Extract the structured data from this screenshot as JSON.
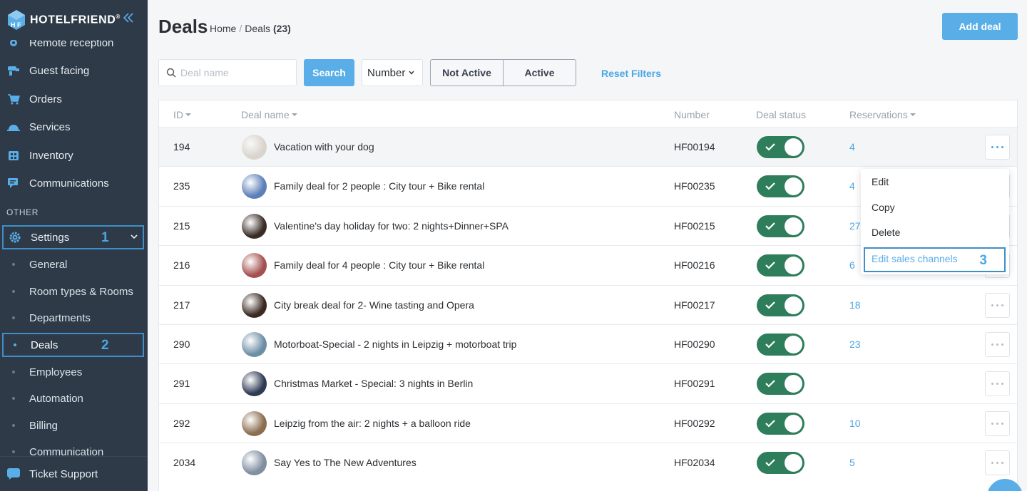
{
  "brand": {
    "name": "HOTELFRIEND",
    "reg": "®"
  },
  "sidebar": {
    "items": [
      {
        "label": "Remote reception",
        "icon": "gear-small-icon"
      },
      {
        "label": "Guest facing",
        "icon": "concierge-icon"
      },
      {
        "label": "Orders",
        "icon": "cart-icon"
      },
      {
        "label": "Services",
        "icon": "cloche-icon"
      },
      {
        "label": "Inventory",
        "icon": "building-icon"
      },
      {
        "label": "Communications",
        "icon": "chat-icon"
      }
    ],
    "section_other": "OTHER",
    "settings": {
      "label": "Settings",
      "step": "1"
    },
    "sub_items": [
      {
        "label": "General"
      },
      {
        "label": "Room types & Rooms"
      },
      {
        "label": "Departments"
      },
      {
        "label": "Deals",
        "step": "2"
      },
      {
        "label": "Employees"
      },
      {
        "label": "Automation"
      },
      {
        "label": "Billing"
      },
      {
        "label": "Communication"
      }
    ],
    "support": {
      "label": "Ticket Support"
    }
  },
  "header": {
    "title": "Deals",
    "breadcrumb": {
      "home": "Home",
      "sep": "/",
      "current": "Deals",
      "count": "(23)"
    },
    "add_button": "Add deal"
  },
  "filters": {
    "search_placeholder": "Deal name",
    "search_button": "Search",
    "select_value": "Number",
    "not_active": "Not Active",
    "active": "Active",
    "reset": "Reset Filters"
  },
  "table": {
    "headers": {
      "id": "ID",
      "name": "Deal name",
      "number": "Number",
      "status": "Deal status",
      "reservations": "Reservations"
    },
    "rows": [
      {
        "id": "194",
        "name": "Vacation with your dog",
        "number": "HF00194",
        "reservations": "4",
        "enabled": true,
        "thumb": "#d9d4cc"
      },
      {
        "id": "235",
        "name": "Family deal for 2 people : City tour + Bike rental",
        "number": "HF00235",
        "reservations": "4",
        "enabled": true,
        "thumb": "#5b7fb8"
      },
      {
        "id": "215",
        "name": "Valentine's day holiday for two: 2 nights+Dinner+SPA",
        "number": "HF00215",
        "reservations": "27",
        "enabled": true,
        "thumb": "#3a2d26"
      },
      {
        "id": "216",
        "name": "Family deal for 4 people : City tour + Bike rental",
        "number": "HF00216",
        "reservations": "6",
        "enabled": true,
        "thumb": "#a45050"
      },
      {
        "id": "217",
        "name": "City break deal for 2- Wine tasting and Opera",
        "number": "HF00217",
        "reservations": "18",
        "enabled": true,
        "thumb": "#3b2a22"
      },
      {
        "id": "290",
        "name": "Motorboat-Special - 2 nights in Leipzig + motorboat trip",
        "number": "HF00290",
        "reservations": "23",
        "enabled": true,
        "thumb": "#6d8fa6"
      },
      {
        "id": "291",
        "name": "Christmas Market - Special: 3 nights in Berlin",
        "number": "HF00291",
        "reservations": "",
        "enabled": true,
        "thumb": "#2f3b55"
      },
      {
        "id": "292",
        "name": "Leipzig from the air: 2 nights + a balloon ride",
        "number": "HF00292",
        "reservations": "10",
        "enabled": true,
        "thumb": "#8b6d4f"
      },
      {
        "id": "2034",
        "name": "Say Yes to The New Adventures",
        "number": "HF02034",
        "reservations": "5",
        "enabled": true,
        "thumb": "#7f8ea0"
      }
    ]
  },
  "menu": {
    "items": [
      "Edit",
      "Copy",
      "Delete"
    ],
    "edit_sales": "Edit sales channels",
    "step": "3"
  },
  "colors": {
    "accent": "#5aaee8",
    "sidebar": "#2e3a48",
    "toggle_on": "#2e7d5b",
    "highlight_box": "#3f8ec7"
  }
}
